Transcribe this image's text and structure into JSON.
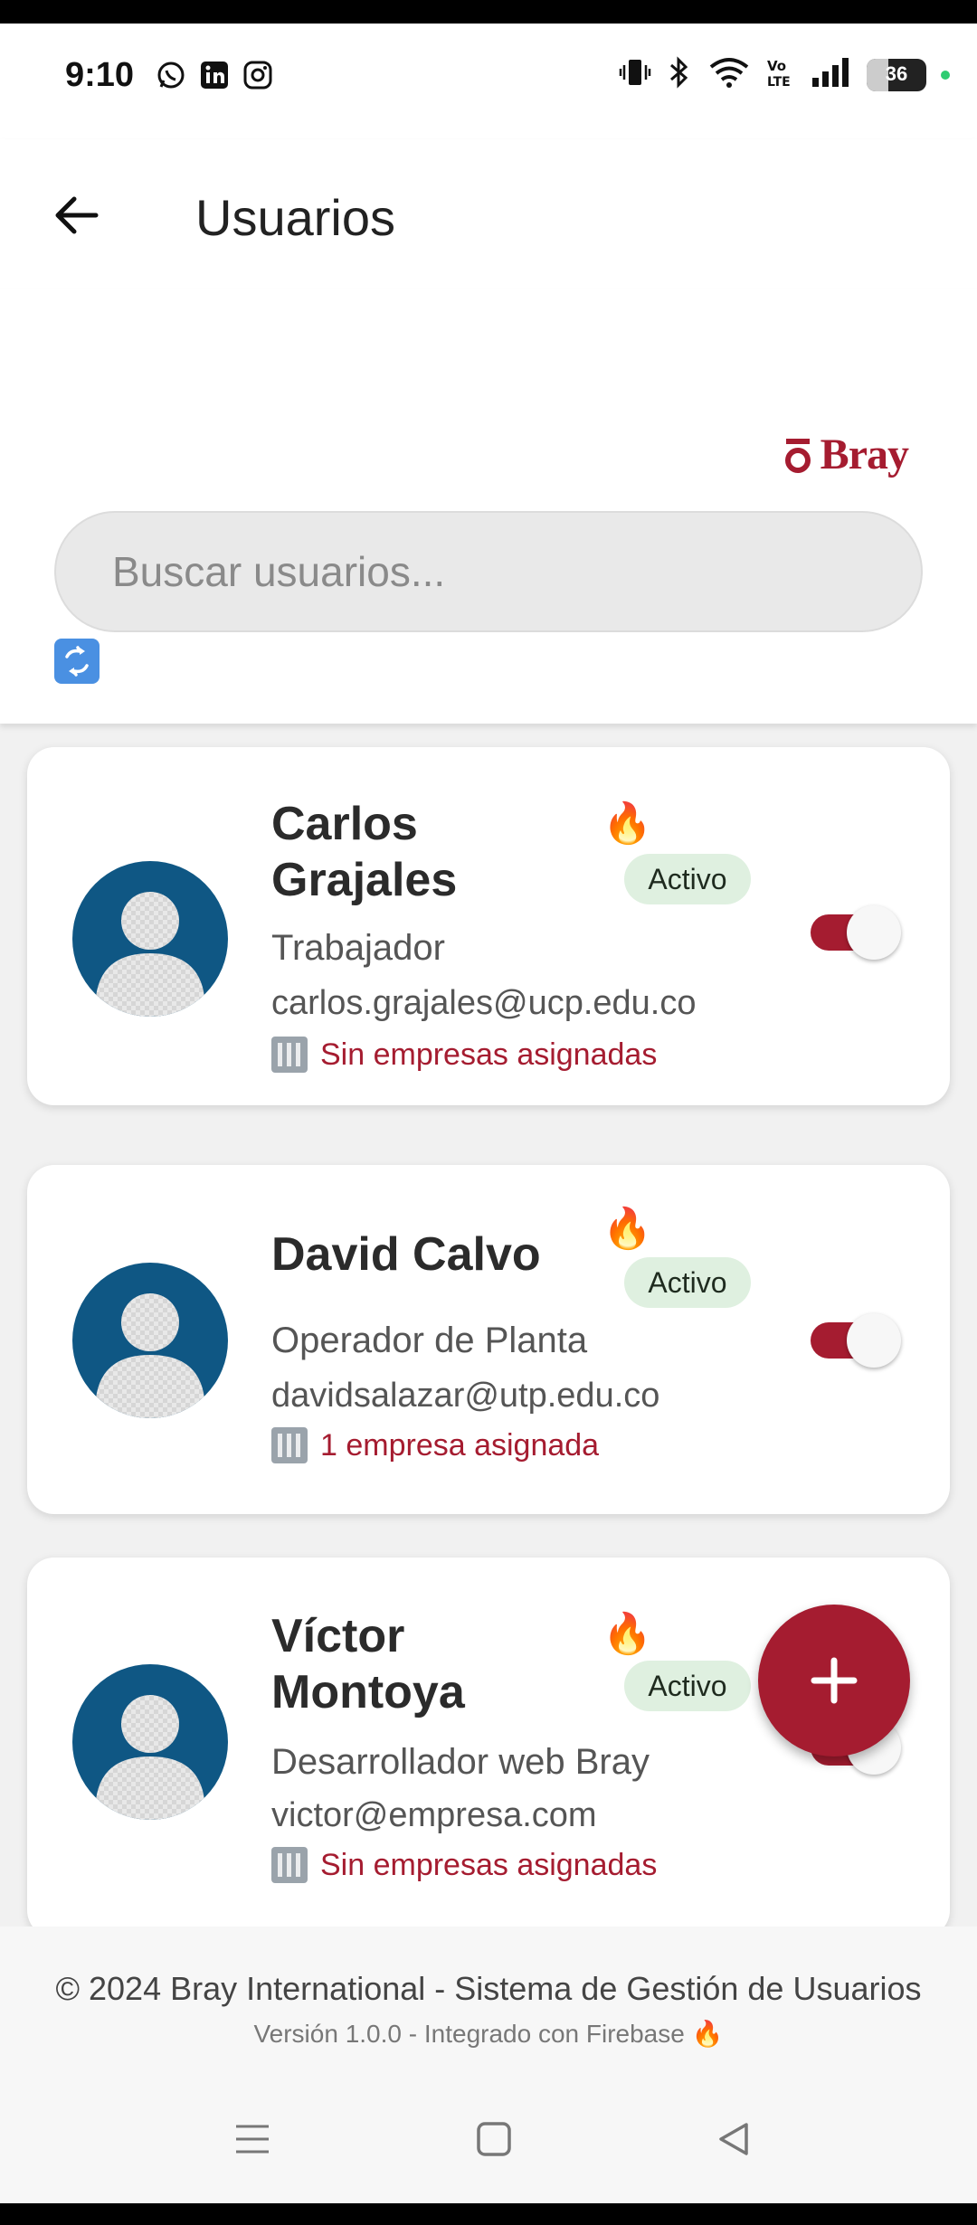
{
  "status_bar": {
    "time": "9:10",
    "battery": "36",
    "app_icons": [
      "whatsapp-icon",
      "linkedin-icon",
      "instagram-icon"
    ],
    "system_icons": [
      "vibrate-icon",
      "bluetooth-icon",
      "wifi-icon",
      "volte-icon",
      "signal-icon",
      "battery-icon"
    ]
  },
  "app_bar": {
    "title": "Usuarios",
    "back_icon": "arrow-left-icon"
  },
  "header": {
    "logo_text": "Bray",
    "search_placeholder": "Buscar usuarios...",
    "refresh_icon": "refresh-icon"
  },
  "users": [
    {
      "name": "Carlos Grajales",
      "status": "Activo",
      "role": "Trabajador",
      "email": "carlos.grajales@ucp.edu.co",
      "companies": "Sin empresas asignadas",
      "enabled": true
    },
    {
      "name": "David Calvo",
      "status": "Activo",
      "role": "Operador de Planta",
      "email": "davidsalazar@utp.edu.co",
      "companies": "1 empresa asignada",
      "enabled": true
    },
    {
      "name": "Víctor Montoya",
      "status": "Activo",
      "role": "Desarrollador web Bray",
      "email": "victor@empresa.com",
      "companies": "Sin empresas asignadas",
      "enabled": true
    }
  ],
  "fab": {
    "icon": "plus-icon"
  },
  "footer": {
    "line1": "© 2024 Bray International - Sistema de Gestión de Usuarios",
    "line2": "Versión 1.0.0 - Integrado con Firebase 🔥"
  },
  "colors": {
    "brand": "#a51c30",
    "avatar": "#0f5784",
    "badge_bg": "#dff0e0"
  }
}
